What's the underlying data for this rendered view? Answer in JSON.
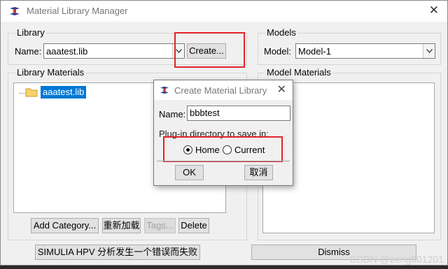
{
  "window": {
    "title": "Material Library Manager",
    "close_glyph": "✕"
  },
  "library": {
    "group_label": "Library",
    "name_label": "Name:",
    "name_value": "aaatest.lib",
    "create_button": "Create..."
  },
  "models": {
    "group_label": "Models",
    "model_label": "Model:",
    "model_value": "Model-1"
  },
  "library_materials": {
    "group_label": "Library Materials",
    "tree_item": "aaatest.lib",
    "buttons": {
      "add_category": "Add Category...",
      "reload": "重新加载",
      "tags": "Tags...",
      "delete": "Delete"
    }
  },
  "model_materials": {
    "group_label": "Model Materials"
  },
  "bottom": {
    "error_button": "SIMULIA HPV 分析发生一个错误而失败",
    "dismiss_button": "Dismiss"
  },
  "dialog": {
    "title": "Create Material Library",
    "close_glyph": "✕",
    "name_label": "Name:",
    "name_value": "bbbtest",
    "dir_label": "Plug-in directory to save in:",
    "radio_home": "Home",
    "radio_current": "Current",
    "selected": "Home",
    "ok": "OK",
    "cancel": "取消"
  },
  "watermark": "CSDN @zeng001201",
  "colors": {
    "highlight_box": "#e0242b",
    "selection": "#0078d7"
  }
}
